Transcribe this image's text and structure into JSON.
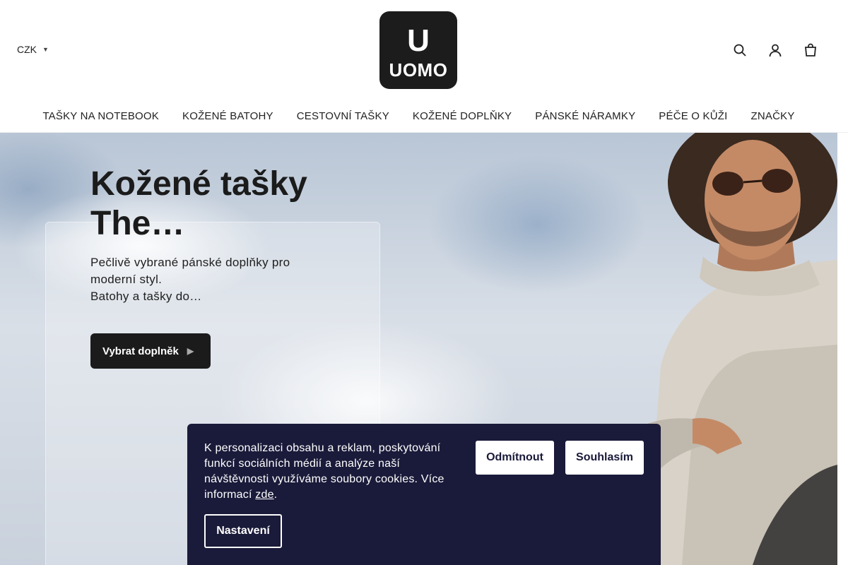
{
  "header": {
    "currency": "CZK",
    "logo": {
      "letter": "U",
      "word": "UOMO"
    },
    "icons": [
      "search-icon",
      "user-icon",
      "cart-icon"
    ]
  },
  "nav": {
    "items": [
      "TAŠKY NA NOTEBOOK",
      "KOŽENÉ BATOHY",
      "CESTOVNÍ TAŠKY",
      "KOŽENÉ DOPLŇKY",
      "PÁNSKÉ NÁRAMKY",
      "PÉČE O KŮŽI",
      "ZNAČKY"
    ]
  },
  "hero": {
    "title": "Kožené tašky The…",
    "desc_line1": "Pečlivě vybrané pánské doplňky pro moderní styl.",
    "desc_line2": "Batohy a tašky do…",
    "button": "Vybrat doplněk"
  },
  "cookie": {
    "text": "K personalizaci obsahu a reklam, poskytování funkcí sociálních médií a analýze naší návštěvnosti využíváme soubory cookies. Více informací",
    "link": "zde",
    "link_suffix": ".",
    "reject": "Odmítnout",
    "accept": "Souhlasím",
    "settings": "Nastavení"
  },
  "colors": {
    "cookie_bg": "#1a1a3a",
    "button_dark": "#1b1b1b",
    "logo_bg": "#1c1c1c"
  }
}
